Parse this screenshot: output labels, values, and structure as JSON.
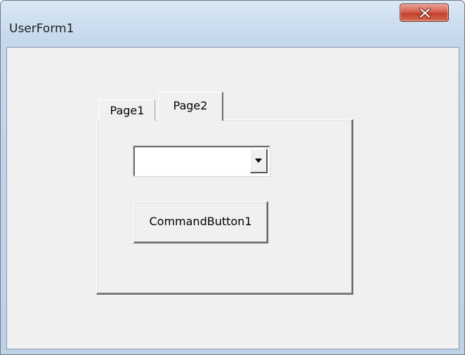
{
  "window": {
    "title": "UserForm1",
    "close_icon": "close-icon"
  },
  "multipage": {
    "tabs": [
      {
        "label": "Page1",
        "selected": false
      },
      {
        "label": "Page2",
        "selected": true
      }
    ]
  },
  "page2": {
    "combobox": {
      "value": "",
      "dropdown_icon": "dropdown-arrow-icon"
    },
    "command_button": {
      "label": "CommandButton1"
    }
  },
  "colors": {
    "form_background": "#f0f0f0",
    "title_bar": "#cddff0",
    "close_button": "#c2402c"
  }
}
